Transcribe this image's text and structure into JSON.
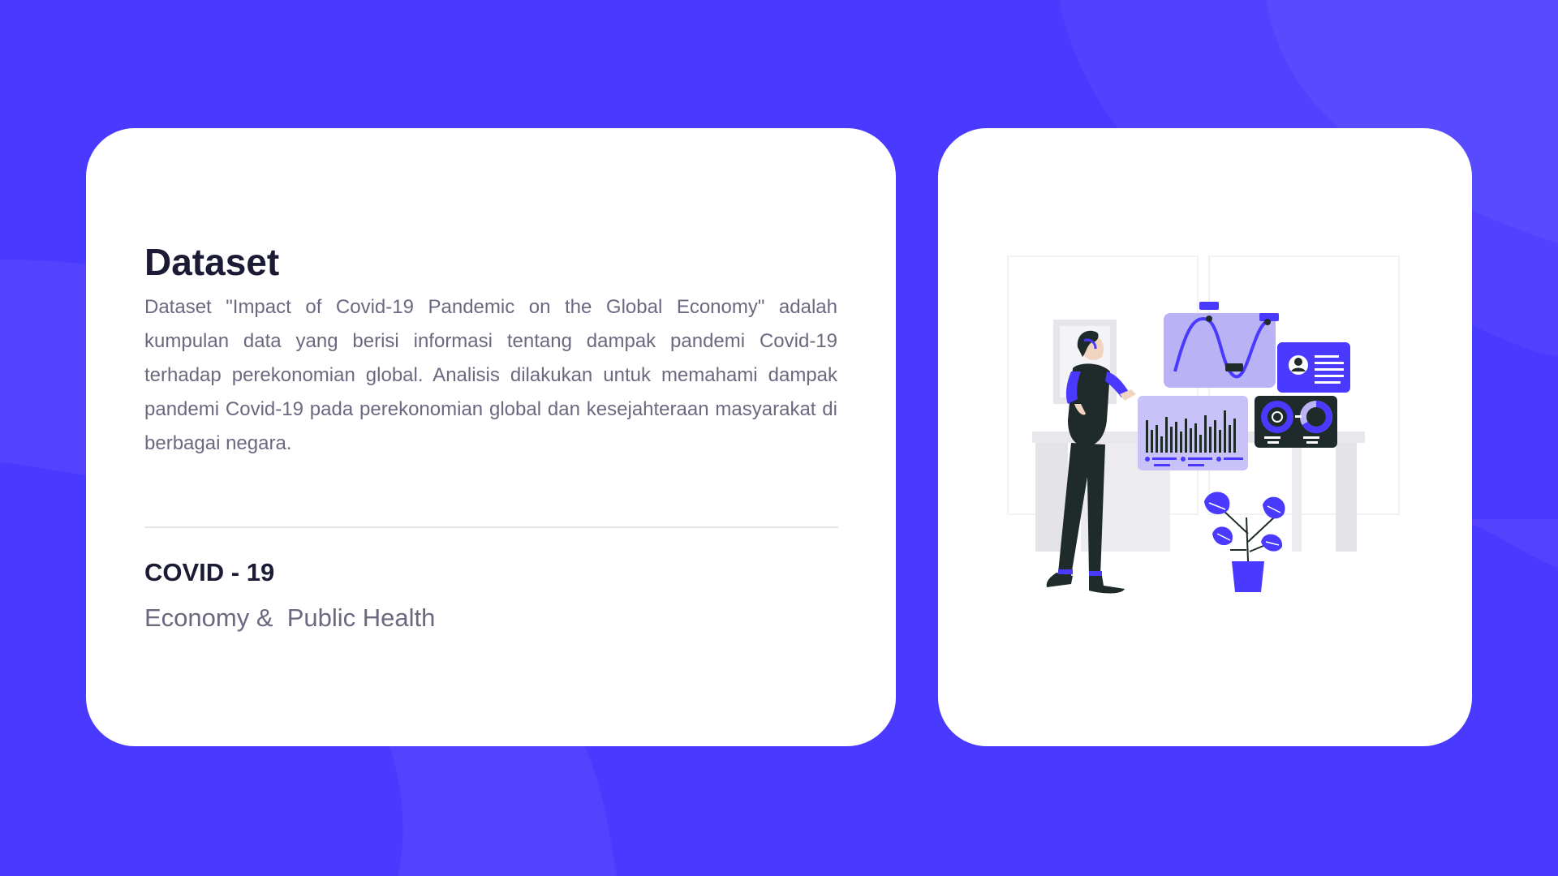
{
  "dataset_card": {
    "title": "Dataset",
    "description": "Dataset \"Impact of Covid-19 Pandemic on the Global Economy\" adalah kumpulan data yang berisi informasi tentang dampak pandemi Covid-19 terhadap perekonomian global. Analisis dilakukan untuk memahami dampak pandemi Covid-19 pada perekonomian global dan kesejahteraan masyarakat di berbagai negara.",
    "topic_title": "COVID - 19",
    "topic_subtitle": "Economy &  Public Health"
  },
  "colors": {
    "background": "#4a3aff",
    "accent": "#4a3aff",
    "accent_light": "#b7b0f7",
    "card": "#ffffff",
    "heading": "#1b1b35",
    "body_text": "#6b6880"
  },
  "illustration": {
    "icon": "data-analyst-illustration"
  }
}
